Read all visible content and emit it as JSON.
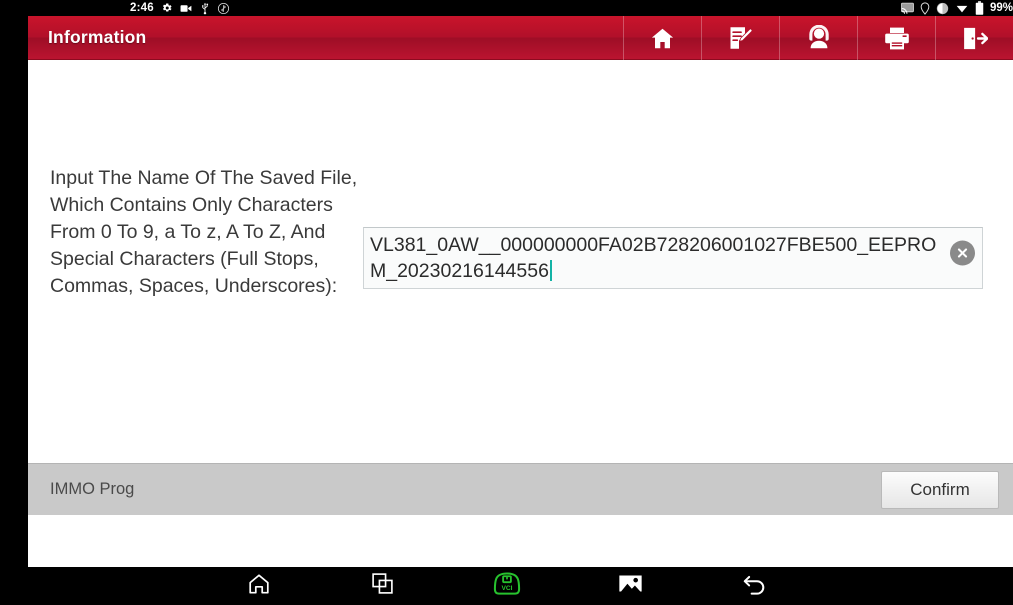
{
  "status_bar": {
    "clock": "2:46",
    "left_icons": [
      "settings-gear-icon",
      "camera-icon",
      "usb-icon",
      "bluetooth-off-icon"
    ],
    "right_icons": [
      "cast-screen-icon",
      "location-icon",
      "volume-icon",
      "download-icon"
    ],
    "battery_percent": "99%"
  },
  "titlebar": {
    "title": "Information",
    "actions": [
      {
        "name": "home-button",
        "icon": "home-icon"
      },
      {
        "name": "feedback-button",
        "icon": "edit-note-icon"
      },
      {
        "name": "support-button",
        "icon": "headset-person-icon"
      },
      {
        "name": "print-button",
        "icon": "printer-icon"
      },
      {
        "name": "exit-button",
        "icon": "exit-door-icon"
      }
    ]
  },
  "main": {
    "prompt": "Input The Name Of The Saved File, Which Contains Only Characters From 0 To 9, a To z, A To Z, And Special Characters (Full Stops, Commas, Spaces, Underscores):",
    "filename_input": {
      "value": "VL381_0AW__000000000FA02B728206001027FBE500_EEPROM_20230216144556",
      "placeholder": "",
      "caret_color": "#13b3a6",
      "clear_icon": "clear-circle-x-icon"
    }
  },
  "footer": {
    "module_label": "IMMO Prog",
    "confirm_label": "Confirm"
  },
  "nav_bar": {
    "buttons": [
      {
        "name": "nav-home-button",
        "icon": "home-outline-icon",
        "color": "#ffffff"
      },
      {
        "name": "nav-recents-button",
        "icon": "recents-squares-icon",
        "color": "#ffffff"
      },
      {
        "name": "nav-vci-button",
        "icon": "vci-connector-icon",
        "label": "VCI",
        "color": "#27c22e"
      },
      {
        "name": "nav-screenshot-button",
        "icon": "image-picture-icon",
        "color": "#ffffff"
      },
      {
        "name": "nav-back-button",
        "icon": "back-arrow-icon",
        "color": "#ffffff"
      }
    ]
  },
  "colors": {
    "brand_red": "#b2102a",
    "footer_gray": "#c9c9c9",
    "accent_teal": "#13b3a6",
    "vci_green": "#27c22e"
  }
}
